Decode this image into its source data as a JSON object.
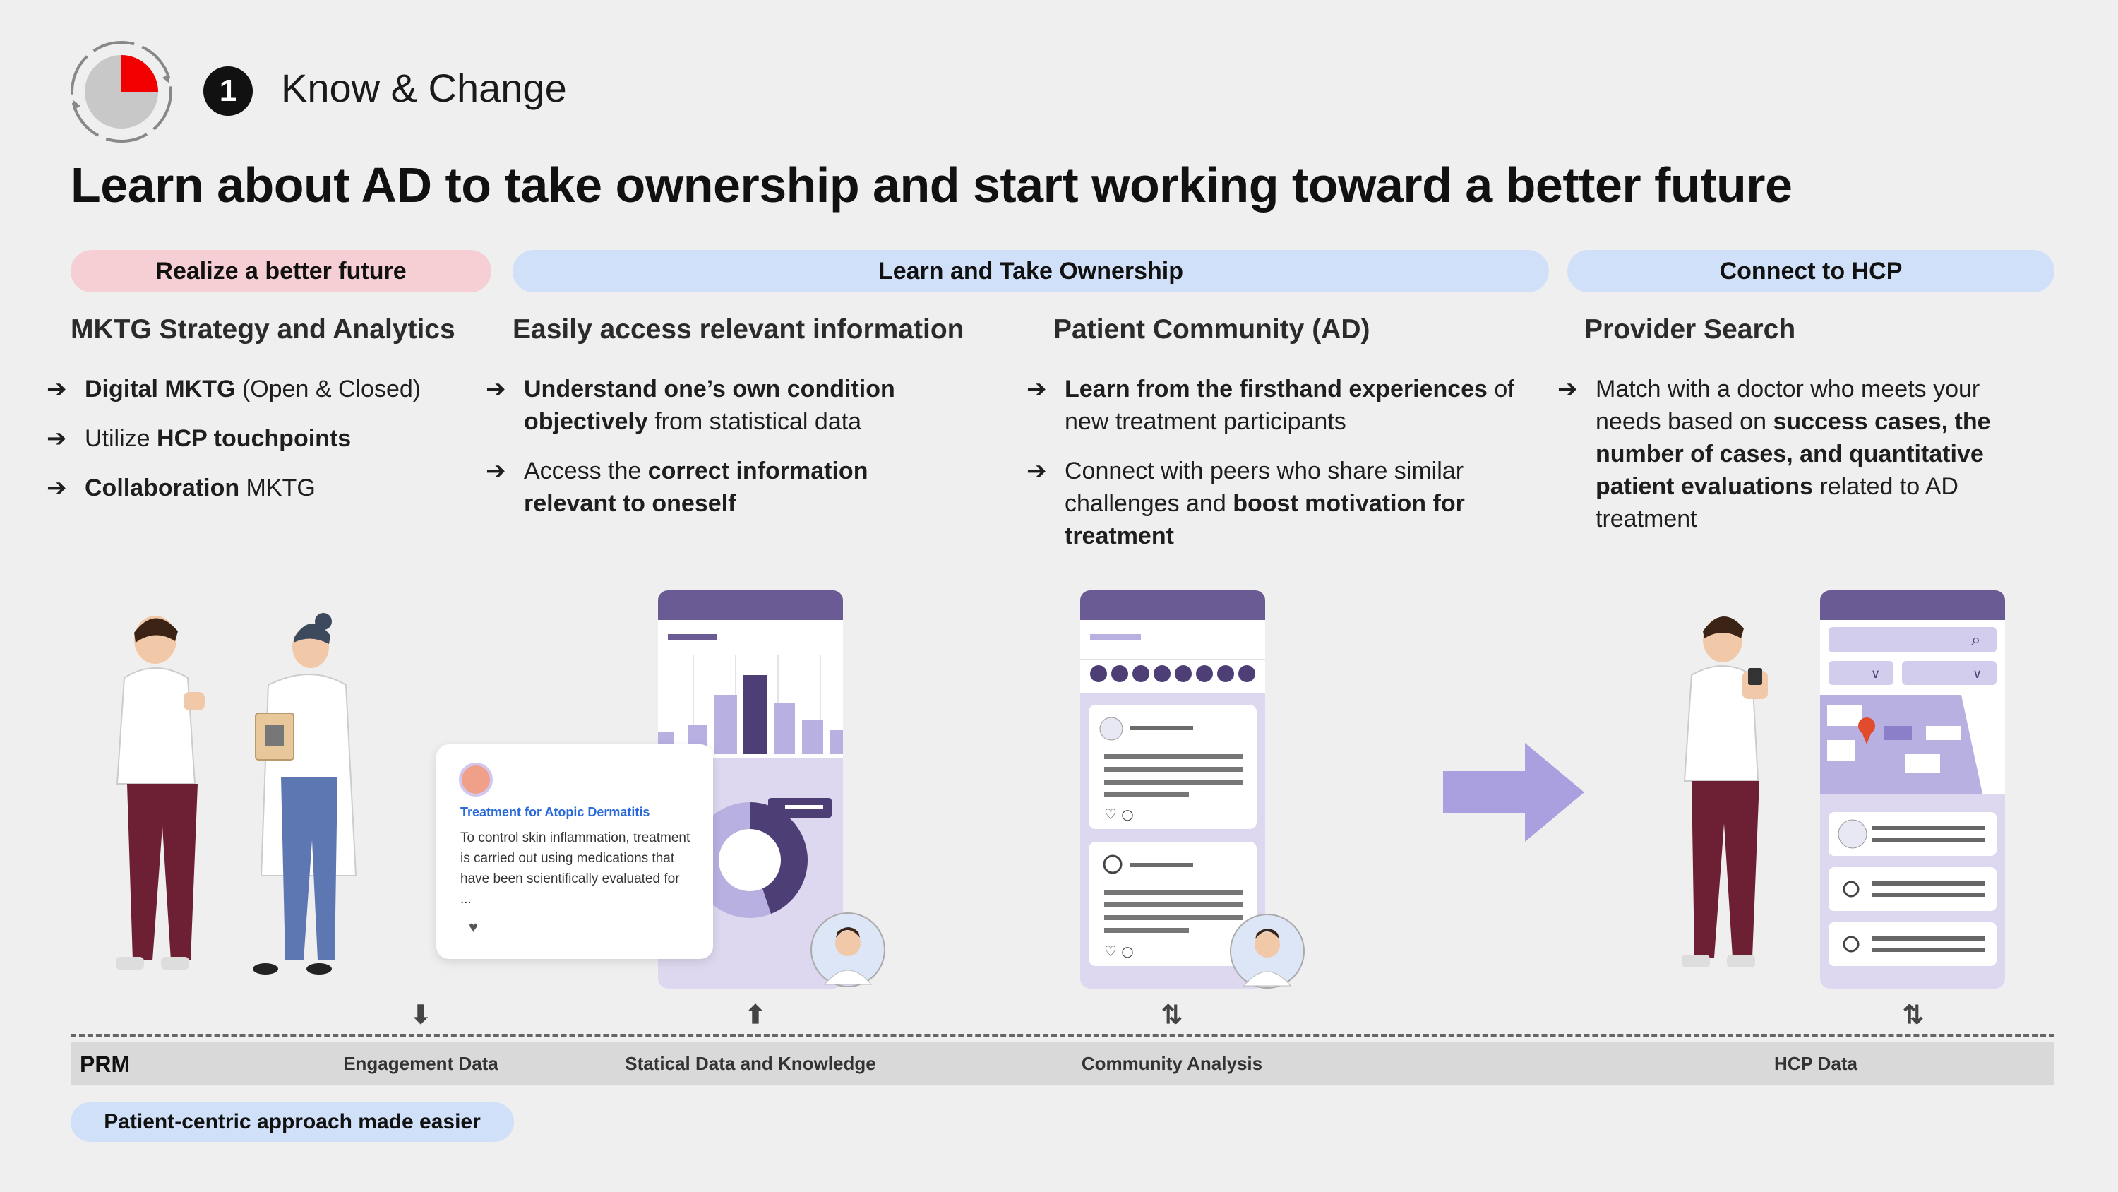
{
  "header": {
    "step_number": "1",
    "step_title": "Know & Change",
    "headline": "Learn about AD to take ownership and start working toward a better future"
  },
  "stages": [
    {
      "label": "Realize a better future",
      "color": "#f5cfd3"
    },
    {
      "label": "Learn and Take Ownership",
      "color": "#cfe0f8"
    },
    {
      "label": "Connect to HCP",
      "color": "#cfe0f8"
    }
  ],
  "columns": [
    {
      "heading": "MKTG Strategy and Analytics",
      "bullets": [
        {
          "bold": "Digital MKTG",
          "rest": " (Open & Closed)"
        },
        {
          "pre": "Utilize ",
          "bold": "HCP touchpoints"
        },
        {
          "bold": "Collaboration",
          "rest": " MKTG"
        }
      ]
    },
    {
      "heading": "Easily access relevant information",
      "bullets": [
        {
          "bold": "Understand one’s own condition objectively",
          "rest": " from statistical data"
        },
        {
          "pre": "Access the ",
          "bold": "correct information relevant to oneself"
        }
      ]
    },
    {
      "heading": "Patient Community (AD)",
      "bullets": [
        {
          "bold": "Learn from the firsthand experiences",
          "rest": " of new treatment participants"
        },
        {
          "pre": "Connect with peers who share similar challenges and ",
          "bold": "boost motivation for treatment"
        }
      ]
    },
    {
      "heading": "Provider Search",
      "bullets": [
        {
          "pre": "Match with a doctor who meets your needs based on ",
          "bold": "success cases, the number of cases, and quantitative patient evaluations",
          "rest": " related to AD treatment"
        }
      ]
    }
  ],
  "info_card": {
    "title": "Treatment for Atopic Dermatitis",
    "body": "To control skin inflammation, treatment is carried out using medications that have been scientifically evaluated for ..."
  },
  "prm": {
    "label": "PRM",
    "items": [
      "Engagement Data",
      "Statical Data and  Knowledge",
      "Community Analysis",
      "HCP Data"
    ]
  },
  "footer": {
    "pill": "Patient-centric approach made easier"
  },
  "icons": {
    "cycle": "cycle-progress-icon",
    "arrow": "right-arrow-icon",
    "flow_down": "down-arrow-icon",
    "flow_up": "up-arrow-icon",
    "flow_both": "bidirectional-arrow-icon"
  },
  "colors": {
    "accent_red": "#f20000",
    "purple_dark": "#5a4a8a",
    "purple_light": "#b9b0e2",
    "pink_pill": "#f5cfd3",
    "blue_pill": "#cfe0f8",
    "big_arrow": "#aaa0e0"
  }
}
